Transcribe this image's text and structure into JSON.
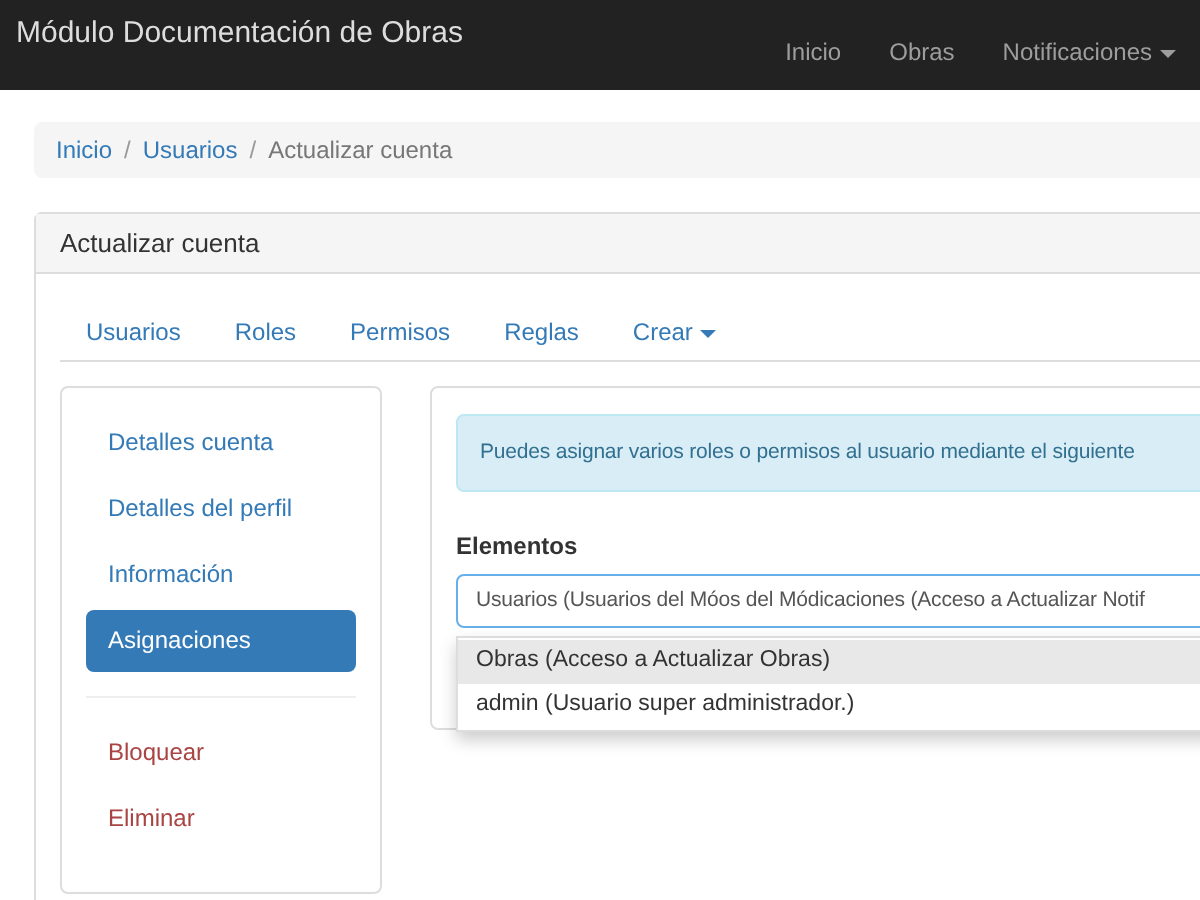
{
  "navbar": {
    "title": "Módulo Documentación de Obras",
    "items": [
      {
        "label": "Inicio",
        "dropdown": false
      },
      {
        "label": "Obras",
        "dropdown": false
      },
      {
        "label": "Notificaciones",
        "dropdown": true
      }
    ]
  },
  "breadcrumb": {
    "separator": "/",
    "items": [
      "Inicio",
      "Usuarios",
      "Actualizar cuenta"
    ]
  },
  "panel": {
    "title": "Actualizar cuenta"
  },
  "tabs": [
    {
      "label": "Usuarios",
      "dropdown": false
    },
    {
      "label": "Roles",
      "dropdown": false
    },
    {
      "label": "Permisos",
      "dropdown": false
    },
    {
      "label": "Reglas",
      "dropdown": false
    },
    {
      "label": "Crear",
      "dropdown": true
    }
  ],
  "sidebar": {
    "groups": [
      [
        {
          "label": "Detalles cuenta",
          "kind": "normal",
          "selected": false
        },
        {
          "label": "Detalles del perfil",
          "kind": "normal",
          "selected": false
        },
        {
          "label": "Información",
          "kind": "normal",
          "selected": false
        },
        {
          "label": "Asignaciones",
          "kind": "normal",
          "selected": true
        }
      ],
      [
        {
          "label": "Bloquear",
          "kind": "danger",
          "selected": false
        },
        {
          "label": "Eliminar",
          "kind": "danger",
          "selected": false
        }
      ]
    ]
  },
  "alert": "Puedes asignar varios roles o permisos al usuario mediante el siguiente",
  "field": {
    "label": "Elementos",
    "value": "Usuarios (Usuarios del Móos del Módicaciones (Acceso a Actualizar Notif",
    "options": [
      {
        "label": "Obras (Acceso a Actualizar Obras)",
        "selected": true
      },
      {
        "label": "admin (Usuario super administrador.)",
        "selected": false
      }
    ]
  }
}
